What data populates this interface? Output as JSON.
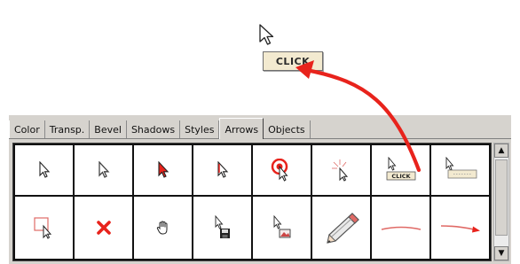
{
  "tooltip": {
    "label": "CLICK"
  },
  "tabs": [
    {
      "label": "Color",
      "active": false
    },
    {
      "label": "Transp.",
      "active": false
    },
    {
      "label": "Bevel",
      "active": false
    },
    {
      "label": "Shadows",
      "active": false
    },
    {
      "label": "Styles",
      "active": false
    },
    {
      "label": "Arrows",
      "active": true
    },
    {
      "label": "Objects",
      "active": false
    }
  ],
  "grid": {
    "row1": [
      "arrow-cursor-icon",
      "arrow-cursor-outline-icon",
      "red-arrow-cursor-icon",
      "red-outline-arrow-cursor-icon",
      "target-cursor-icon",
      "sparkle-cursor-icon",
      "cursor-click-label-icon",
      "cursor-label-icon"
    ],
    "row2": [
      "selection-box-cursor-icon",
      "red-x-icon",
      "hand-cursor-icon",
      "cursor-save-icon",
      "cursor-image-icon",
      "pencil-icon",
      "red-curve-icon",
      "red-curve-arrow-icon"
    ],
    "mini_label": "CLICK"
  },
  "colors": {
    "accent_red": "#e8231c",
    "panel": "#d6d3ce",
    "tooltip_bg": "#f3ead0"
  }
}
